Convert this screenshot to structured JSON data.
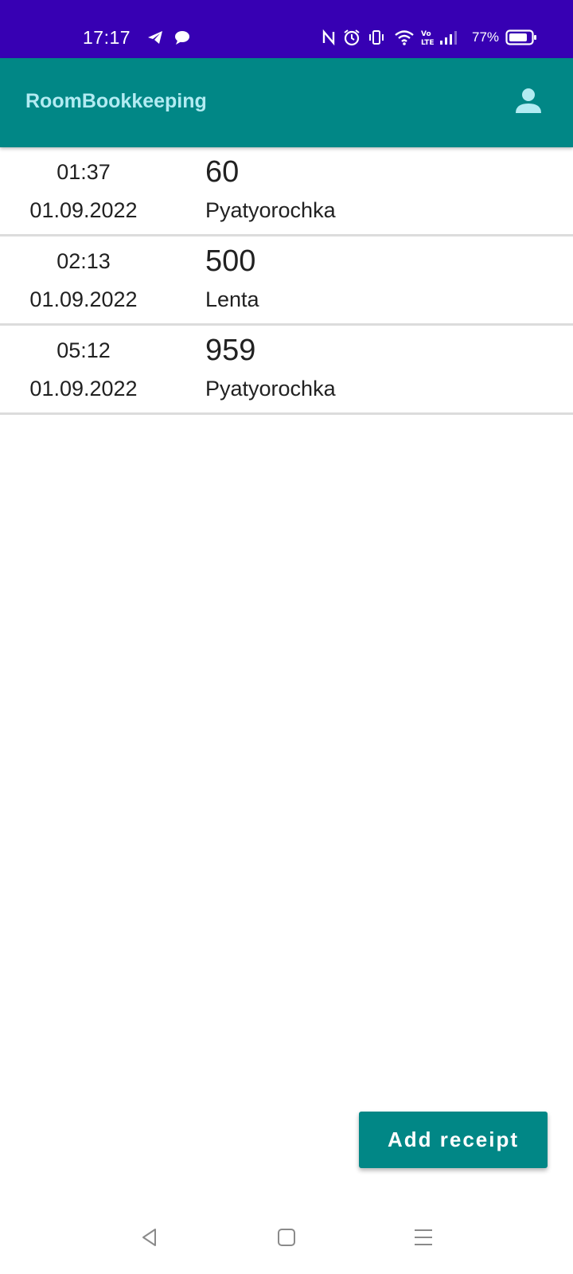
{
  "status_bar": {
    "time": "17:17",
    "battery_percent": "77%",
    "icons": [
      "telegram-icon",
      "chat-bubble-icon",
      "nfc-icon",
      "alarm-icon",
      "vibrate-icon",
      "wifi-icon",
      "volte-icon",
      "signal-icon",
      "battery-icon"
    ]
  },
  "app_bar": {
    "title": "RoomBookkeeping",
    "account_icon": "account-icon"
  },
  "receipts": [
    {
      "time": "01:37",
      "date": "01.09.2022",
      "amount": "60",
      "store": "Pyatyorochka"
    },
    {
      "time": "02:13",
      "date": "01.09.2022",
      "amount": "500",
      "store": "Lenta"
    },
    {
      "time": "05:12",
      "date": "01.09.2022",
      "amount": "959",
      "store": "Pyatyorochka"
    }
  ],
  "add_button": {
    "label": "Add receipt"
  },
  "nav_bar": {
    "back_icon": "back-triangle-icon",
    "home_icon": "home-square-icon",
    "menu_icon": "menu-lines-icon"
  },
  "colors": {
    "status_bar": "#3700b3",
    "primary": "#018786",
    "title_text": "#b2ebf2",
    "divider": "#dcdcdc"
  }
}
